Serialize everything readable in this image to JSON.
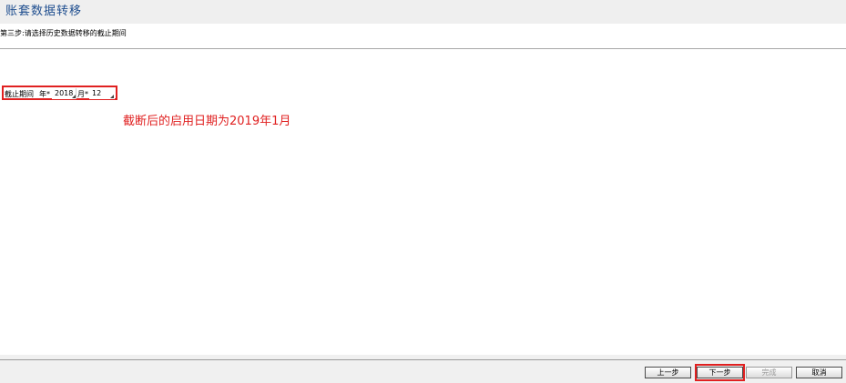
{
  "window": {
    "title": "账套数据转移"
  },
  "step": {
    "instruction": "第三步:请选择历史数据转移的截止期间"
  },
  "period": {
    "label": "截止期间",
    "year_label": "年*",
    "year_value": "2018",
    "month_label": "月*",
    "month_value": "12"
  },
  "annotation": {
    "text": "截断后的启用日期为2019年1月",
    "color": "#e02020"
  },
  "buttons": {
    "prev": "上一步",
    "next": "下一步",
    "finish": "完成",
    "cancel": "取消"
  },
  "colors": {
    "title": "#1f4e8f",
    "highlight": "#e02020"
  }
}
